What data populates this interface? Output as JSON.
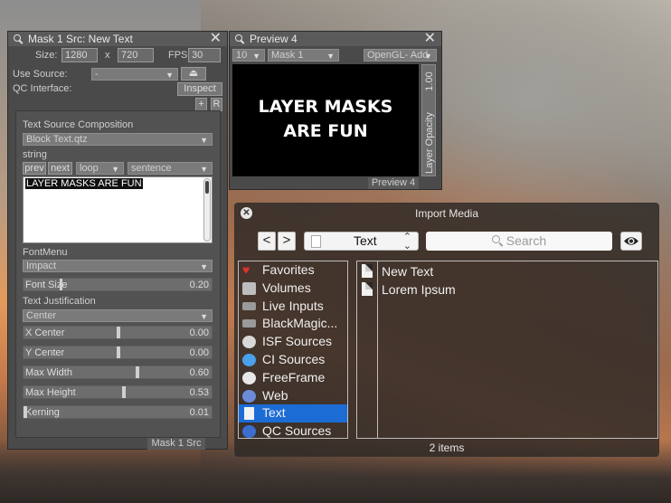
{
  "mask_panel": {
    "title": "Mask 1 Src: New Text",
    "size_label": "Size:",
    "width": "1280",
    "x_label": "x",
    "height": "720",
    "fps_label": "FPS:",
    "fps": "30",
    "use_source_label": "Use Source:",
    "use_source_value": "-",
    "qc_interface_label": "QC Interface:",
    "inspect_label": "Inspect",
    "plus_label": "+",
    "r_label": "R",
    "composition_label": "Text Source Composition",
    "composition_value": "Block Text.qtz",
    "string_label": "string",
    "prev_label": "prev",
    "next_label": "next",
    "loop_value": "loop",
    "sentence_value": "sentence",
    "text_value": "LAYER MASKS ARE FUN",
    "font_menu_label": "FontMenu",
    "font_value": "Impact",
    "font_size": {
      "name": "Font Size",
      "value": "0.20",
      "fraction": 0.2
    },
    "justification_label": "Text Justification",
    "justification_value": "Center",
    "sliders": [
      {
        "name": "X Center",
        "value": "0.00",
        "fraction": 0.5
      },
      {
        "name": "Y Center",
        "value": "0.00",
        "fraction": 0.5
      },
      {
        "name": "Max Width",
        "value": "0.60",
        "fraction": 0.6
      },
      {
        "name": "Max Height",
        "value": "0.53",
        "fraction": 0.53
      },
      {
        "name": "Kerning",
        "value": "0.01",
        "fraction": 0.0
      }
    ],
    "footer_tab": "Mask 1 Src"
  },
  "preview_panel": {
    "title": "Preview 4",
    "zoom_value": "10",
    "layer_value": "Mask 1",
    "renderer_value": "OpenGL- Add",
    "canvas_line1": "LAYER MASKS",
    "canvas_line2": "ARE FUN",
    "opacity_value": "1.00",
    "opacity_label": "Layer Opacity",
    "opacity_fraction": 1.0,
    "footer_tab": "Preview 4"
  },
  "import_media": {
    "title": "Import Media",
    "back_label": "<",
    "forward_label": ">",
    "path_value": "Text",
    "search_placeholder": "Search",
    "sidebar": [
      {
        "label": "Favorites",
        "icon": "heart-icon",
        "color": "#e0312b"
      },
      {
        "label": "Volumes",
        "icon": "drive-icon",
        "color": "#bdbdbd"
      },
      {
        "label": "Live Inputs",
        "icon": "camera-icon",
        "color": "#9a9a9a"
      },
      {
        "label": "BlackMagic...",
        "icon": "camera-icon",
        "color": "#9a9a9a"
      },
      {
        "label": "ISF Sources",
        "icon": "isf-icon",
        "color": "#d8d8d8"
      },
      {
        "label": "CI Sources",
        "icon": "ci-icon",
        "color": "#4aa0ea"
      },
      {
        "label": "FreeFrame",
        "icon": "freeframe-icon",
        "color": "#e8e8e8"
      },
      {
        "label": "Web",
        "icon": "globe-icon",
        "color": "#6c8bd8"
      },
      {
        "label": "Text",
        "icon": "document-icon",
        "color": "#f2f2f2",
        "selected": true
      },
      {
        "label": "QC Sources",
        "icon": "qc-icon",
        "color": "#3c6ed0"
      }
    ],
    "files": [
      "New Text",
      "Lorem Ipsum"
    ],
    "footer": "2 items"
  }
}
